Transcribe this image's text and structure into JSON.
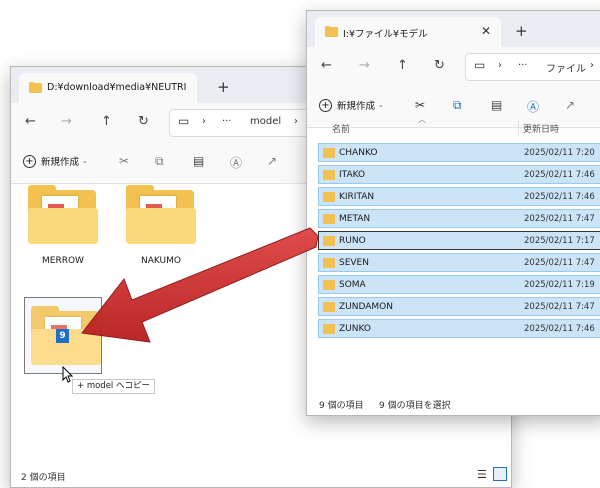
{
  "left_window": {
    "tab_title": "D:¥download¥media¥NEUTRI",
    "address_more": "···",
    "address_segment": "model",
    "new_label": "新規作成",
    "folders": [
      {
        "name": "MERROW"
      },
      {
        "name": "NAKUMO"
      }
    ],
    "drag_badge": "9",
    "copy_tooltip": "+ model へコピー",
    "status_count": "2 個の項目"
  },
  "right_window": {
    "tab_title": "I:¥ファイル¥モデル",
    "address_more": "···",
    "address_segment": "ファイル",
    "new_label": "新規作成",
    "col_name": "名前",
    "col_date": "更新日時",
    "rows": [
      {
        "name": "CHANKO",
        "date": "2025/02/11 7:20"
      },
      {
        "name": "ITAKO",
        "date": "2025/02/11 7:46"
      },
      {
        "name": "KIRITAN",
        "date": "2025/02/11 7:46"
      },
      {
        "name": "METAN",
        "date": "2025/02/11 7:47"
      },
      {
        "name": "RUNO",
        "date": "2025/02/11 7:17"
      },
      {
        "name": "SEVEN",
        "date": "2025/02/11 7:47"
      },
      {
        "name": "SOMA",
        "date": "2025/02/11 7:19"
      },
      {
        "name": "ZUNDAMON",
        "date": "2025/02/11 7:47"
      },
      {
        "name": "ZUNKO",
        "date": "2025/02/11 7:46"
      }
    ],
    "status_count": "9 個の項目",
    "status_selected": "9 個の項目を選択"
  },
  "colors": {
    "selection_fill": "#cce4f7",
    "selection_border": "#99c9ef",
    "folder": "#f3c152",
    "arrow": "#d22d2d",
    "badge": "#1f6fc5"
  }
}
